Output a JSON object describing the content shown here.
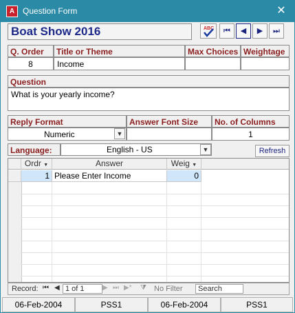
{
  "window": {
    "title": "Question Form",
    "icon_text": "A",
    "close_glyph": "✕"
  },
  "form_title": "Boat Show 2016",
  "nav_glyphs": {
    "first": "⏮",
    "prev": "◀",
    "next": "▶",
    "last": "⏭"
  },
  "header_labels": {
    "q_order": "Q. Order",
    "title_theme": "Title or Theme",
    "max_choices": "Max Choices",
    "weightage": "Weightage"
  },
  "header_values": {
    "q_order": "8",
    "title_theme": "Income",
    "max_choices": "",
    "weightage": ""
  },
  "question": {
    "label": "Question",
    "text": "What is your yearly income?"
  },
  "reply": {
    "format_label": "Reply Format",
    "font_size_label": "Answer Font Size",
    "columns_label": "No. of Columns",
    "format_value": "Numeric",
    "font_size_value": "",
    "columns_value": "1"
  },
  "language": {
    "label": "Language:",
    "value": "English - US",
    "refresh_label": "Refresh"
  },
  "grid": {
    "columns": [
      "Ordr",
      "Answer",
      "Weig"
    ],
    "rows": [
      {
        "order": "1",
        "answer": "Please Enter Income",
        "weight": "0"
      }
    ]
  },
  "record_nav": {
    "label": "Record:",
    "position": "1 of 1",
    "filter": "No Filter",
    "search_placeholder": "Search"
  },
  "status": [
    "06-Feb-2004",
    "PSS1",
    "06-Feb-2004",
    "PSS1"
  ],
  "colors": {
    "titlebar": "#2b8aa6",
    "label_text": "#8b1e1e",
    "form_title": "#1e2a8a",
    "selected_cell": "#cfe6fb"
  }
}
